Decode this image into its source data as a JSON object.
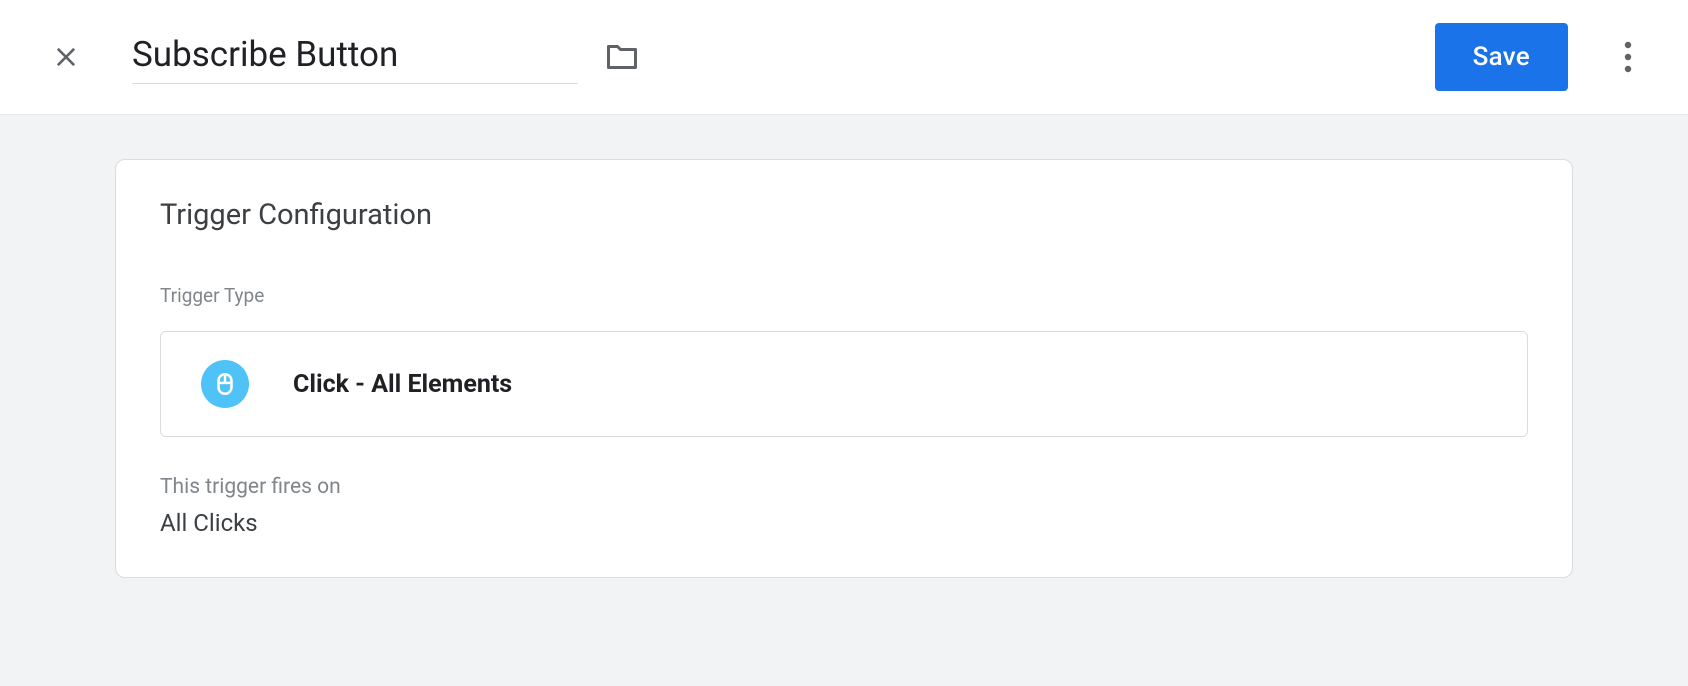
{
  "header": {
    "title": "Subscribe Button",
    "save_label": "Save"
  },
  "card": {
    "title": "Trigger Configuration",
    "trigger_type_label": "Trigger Type",
    "trigger_type_value": "Click - All Elements",
    "fires_on_label": "This trigger fires on",
    "fires_on_value": "All Clicks"
  },
  "colors": {
    "primary": "#1a73e8",
    "icon_bg": "#4fc3f7",
    "text_primary": "#202124",
    "text_secondary": "#80868b",
    "border": "#dadce0",
    "content_bg": "#f1f3f4"
  }
}
